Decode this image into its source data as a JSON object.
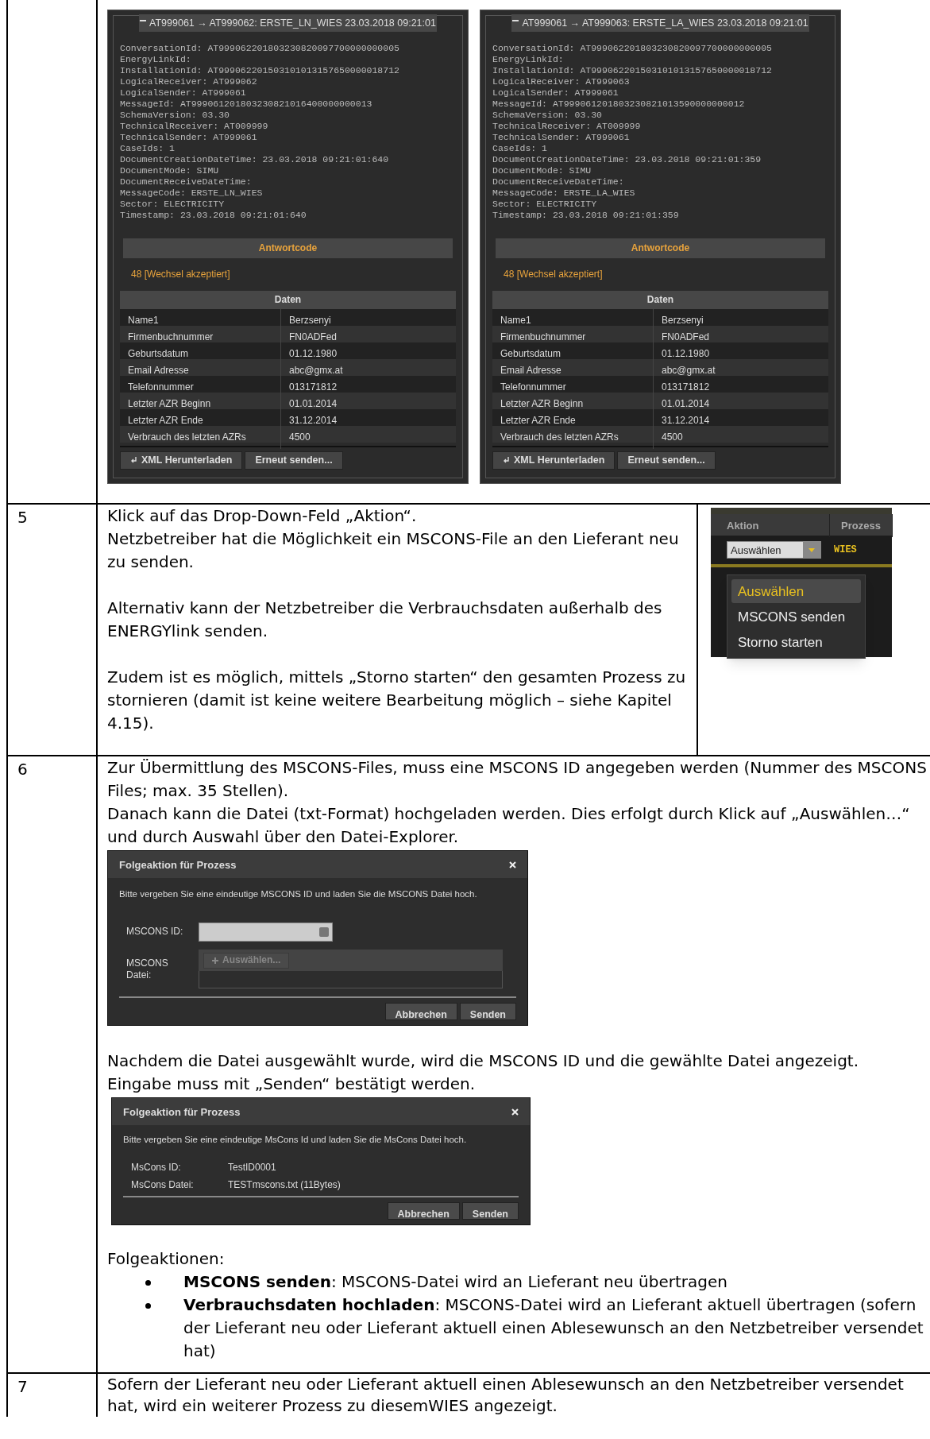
{
  "log_panels": [
    {
      "title": "AT999061 → AT999062: ERSTE_LN_WIES 23.03.2018 09:21:01",
      "fields": [
        "ConversationId: AT999062201803230820097700000000005",
        "EnergyLinkId:",
        "InstallationId: AT999062201503101013157650000018712",
        "LogicalReceiver: AT999062",
        "LogicalSender: AT999061",
        "MessageId: AT999061201803230821016400000000013",
        "SchemaVersion: 03.30",
        "TechnicalReceiver: AT009999",
        "TechnicalSender: AT999061",
        "CaseIds: 1",
        "DocumentCreationDateTime: 23.03.2018 09:21:01:640",
        "DocumentMode: SIMU",
        "DocumentReceiveDateTime:",
        "MessageCode: ERSTE_LN_WIES",
        "Sector: ELECTRICITY",
        "Timestamp: 23.03.2018 09:21:01:640"
      ],
      "response_header": "Antwortcode",
      "response_code": "48 [Wechsel akzeptiert]",
      "data_header": "Daten",
      "data_rows": [
        {
          "label": "Name1",
          "value": "Berzsenyi"
        },
        {
          "label": "Firmenbuchnummer",
          "value": "FN0ADFed"
        },
        {
          "label": "Geburtsdatum",
          "value": "01.12.1980"
        },
        {
          "label": "Email Adresse",
          "value": "abc@gmx.at"
        },
        {
          "label": "Telefonnummer",
          "value": "013171812"
        },
        {
          "label": "Letzter AZR Beginn",
          "value": "01.01.2014"
        },
        {
          "label": "Letzter AZR Ende",
          "value": "31.12.2014"
        },
        {
          "label": "Verbrauch des letzten AZRs",
          "value": "4500"
        }
      ],
      "buttons": [
        {
          "label": "XML Herunterladen",
          "kind": "download"
        },
        {
          "label": "Erneut senden...",
          "kind": "plain"
        }
      ]
    },
    {
      "title": "AT999061 → AT999063: ERSTE_LA_WIES 23.03.2018 09:21:01",
      "fields": [
        "ConversationId: AT999062201803230820097700000000005",
        "EnergyLinkId:",
        "InstallationId: AT999062201503101013157650000018712",
        "LogicalReceiver: AT999063",
        "LogicalSender: AT999061",
        "MessageId: AT999061201803230821013590000000012",
        "SchemaVersion: 03.30",
        "TechnicalReceiver: AT009999",
        "TechnicalSender: AT999061",
        "CaseIds: 1",
        "DocumentCreationDateTime: 23.03.2018 09:21:01:359",
        "DocumentMode: SIMU",
        "DocumentReceiveDateTime:",
        "MessageCode: ERSTE_LA_WIES",
        "Sector: ELECTRICITY",
        "Timestamp: 23.03.2018 09:21:01:359"
      ],
      "response_header": "Antwortcode",
      "response_code": "48 [Wechsel akzeptiert]",
      "data_header": "Daten",
      "data_rows": [
        {
          "label": "Name1",
          "value": "Berzsenyi"
        },
        {
          "label": "Firmenbuchnummer",
          "value": "FN0ADFed"
        },
        {
          "label": "Geburtsdatum",
          "value": "01.12.1980"
        },
        {
          "label": "Email Adresse",
          "value": "abc@gmx.at"
        },
        {
          "label": "Telefonnummer",
          "value": "013171812"
        },
        {
          "label": "Letzter AZR Beginn",
          "value": "01.01.2014"
        },
        {
          "label": "Letzter AZR Ende",
          "value": "31.12.2014"
        },
        {
          "label": "Verbrauch des letzten AZRs",
          "value": "4500"
        }
      ],
      "buttons": [
        {
          "label": "XML Herunterladen",
          "kind": "download"
        },
        {
          "label": "Erneut senden...",
          "kind": "plain"
        }
      ]
    }
  ],
  "step_5": {
    "number": "5",
    "blocks": [
      [
        "Klick auf das Drop-Down-Feld „Aktion“.",
        "Netzbetreiber hat die Möglichkeit ein MSCONS-File an den Lieferant neu zu senden."
      ],
      [
        "Alternativ kann der Netzbetreiber die Verbrauchsdaten außerhalb des ENERGYlink senden."
      ],
      [
        "Zudem ist es möglich, mittels „Storno starten“ den gesamten Prozess zu stornieren (damit ist keine weitere Bearbeitung möglich – siehe Kapitel 4.15)."
      ]
    ],
    "dropdown": {
      "columns": [
        "Aktion",
        "Prozess"
      ],
      "value": "Auswählen",
      "process": "WIES",
      "options": [
        {
          "label": "Auswählen",
          "selected": true
        },
        {
          "label": "MSCONS senden",
          "selected": false
        },
        {
          "label": "Storno starten",
          "selected": false
        }
      ]
    }
  },
  "step_6": {
    "number": "6",
    "intro": [
      "Zur Übermittlung des MSCONS-Files, muss eine MSCONS ID angegeben werden (Nummer des MSCONS Files; max. 35 Stellen).",
      "Danach kann die Datei (txt-Format) hochgeladen werden. Dies erfolgt durch Klick auf „Auswählen…“ und durch Auswahl über den Datei-Explorer."
    ],
    "upload_dialog": {
      "title": "Folgeaktion für Prozess",
      "instructions": "Bitte vergeben Sie eine eindeutige MSCONS ID und laden Sie die MSCONS Datei hoch.",
      "id_label": "MSCONS ID:",
      "file_label": "MSCONS Datei:",
      "choose_button": "Auswählen...",
      "buttons": [
        "Abbrechen",
        "Senden"
      ]
    },
    "middle": [
      "Nachdem die Datei ausgewählt wurde, wird die MSCONS ID und die gewählte Datei angezeigt.",
      "Eingabe muss mit „Senden“ bestätigt werden."
    ],
    "confirm_dialog": {
      "title": "Folgeaktion für Prozess",
      "instructions": "Bitte vergeben Sie eine eindeutige MsCons Id und laden Sie die MsCons Datei hoch.",
      "fields": [
        {
          "label": "MsCons ID:",
          "value": "TestID0001"
        },
        {
          "label": "MsCons Datei:",
          "value": "TESTmscons.txt (11Bytes)"
        }
      ],
      "buttons": [
        "Abbrechen",
        "Senden"
      ]
    },
    "followups_heading": "Folgeaktionen:",
    "followups": [
      "**MSCONS senden**: MSCONS-Datei wird an Lieferant neu übertragen",
      "**Verbrauchsdaten hochladen**: MSCONS-Datei wird an Lieferant aktuell übertragen (sofern der Lieferant neu oder Lieferant aktuell einen Ablesewunsch an den Netzbetreiber versendet hat)"
    ]
  },
  "step_7": {
    "number": "7",
    "text": "Sofern der Lieferant neu oder Lieferant aktuell einen Ablesewunsch an den Netzbetreiber versendet hat, wird ein weiterer Prozess zu diesemWIES angezeigt."
  }
}
